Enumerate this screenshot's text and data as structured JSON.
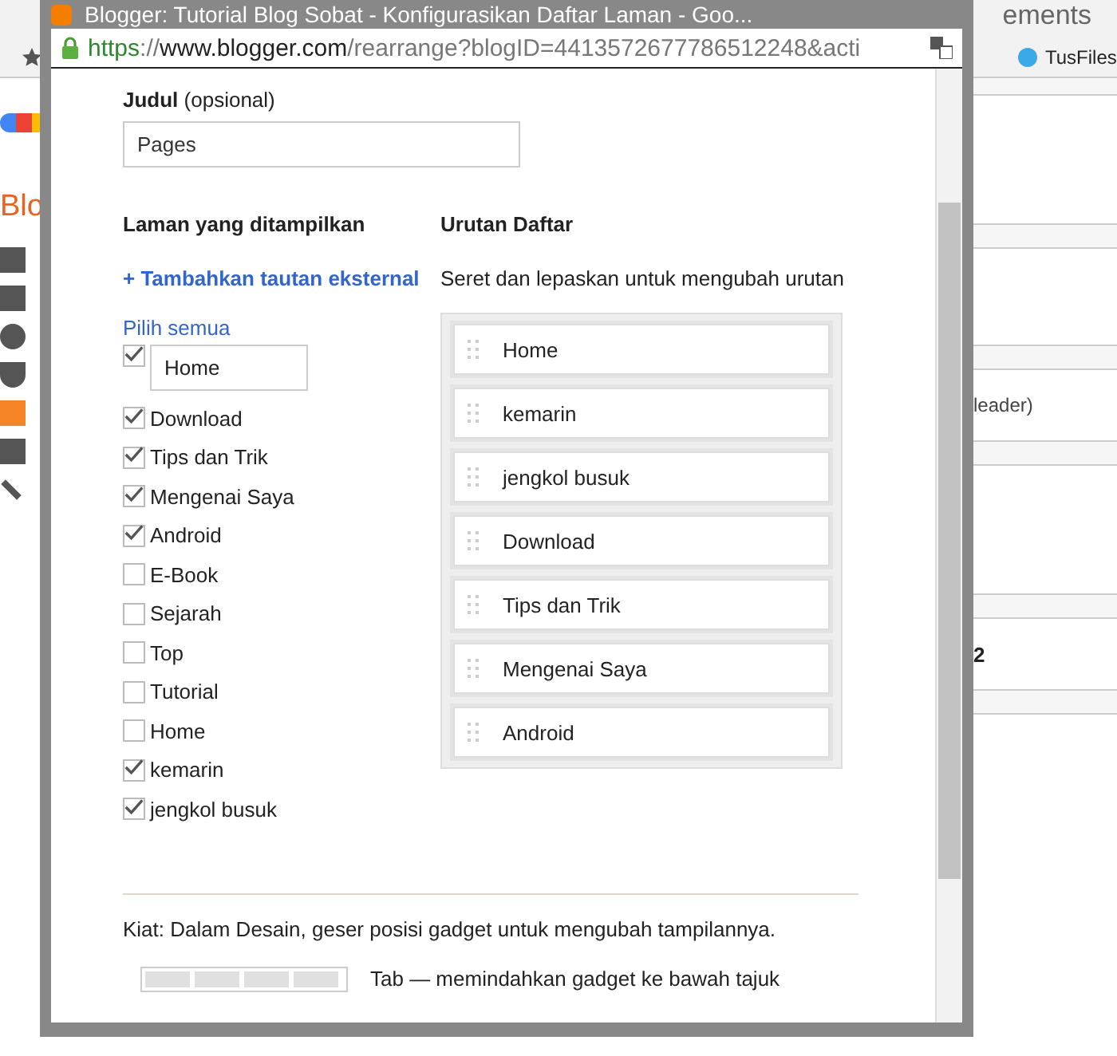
{
  "browser_background": {
    "tab_title": "ements",
    "bookmark": "TusFiles",
    "brand_text": "Blo",
    "panel_text": "leader)",
    "panel_number": "2"
  },
  "popup": {
    "title": "Blogger: Tutorial Blog Sobat - Konfigurasikan Daftar Laman - Goo...",
    "url_scheme": "https",
    "url_separator": "://",
    "url_host": "www.blogger.com",
    "url_path": "/rearrange?blogID=4413572677786512248&acti"
  },
  "title_field": {
    "label": "Judul",
    "label_note": "(opsional)",
    "value": "Pages"
  },
  "shown_pages": {
    "heading": "Laman yang ditampilkan",
    "add_link": "+ Tambahkan tautan eksternal",
    "select_all": "Pilih semua",
    "items": [
      {
        "kind": "editable",
        "label": "Home",
        "checked": true
      },
      {
        "kind": "page",
        "label": "Download",
        "checked": true
      },
      {
        "kind": "page",
        "label": "Tips dan Trik",
        "checked": true
      },
      {
        "kind": "page",
        "label": "Mengenai Saya",
        "checked": true
      },
      {
        "kind": "page",
        "label": "Android",
        "checked": true
      },
      {
        "kind": "page",
        "label": "E-Book",
        "checked": false
      },
      {
        "kind": "page",
        "label": "Sejarah",
        "checked": false
      },
      {
        "kind": "page",
        "label": "Top",
        "checked": false
      },
      {
        "kind": "page",
        "label": "Tutorial",
        "checked": false
      },
      {
        "kind": "page",
        "label": "Home",
        "checked": false
      },
      {
        "kind": "page",
        "label": "kemarin",
        "checked": true
      },
      {
        "kind": "page",
        "label": "jengkol busuk",
        "checked": true
      }
    ]
  },
  "order": {
    "heading": "Urutan Daftar",
    "hint": "Seret dan lepaskan untuk mengubah urutan",
    "items": [
      "Home",
      "kemarin",
      "jengkol busuk",
      "Download",
      "Tips dan Trik",
      "Mengenai Saya",
      "Android"
    ]
  },
  "tip": "Kiat: Dalam Desain, geser posisi gadget untuk mengubah tampilannya.",
  "tab_hint": "Tab — memindahkan gadget ke bawah tajuk"
}
